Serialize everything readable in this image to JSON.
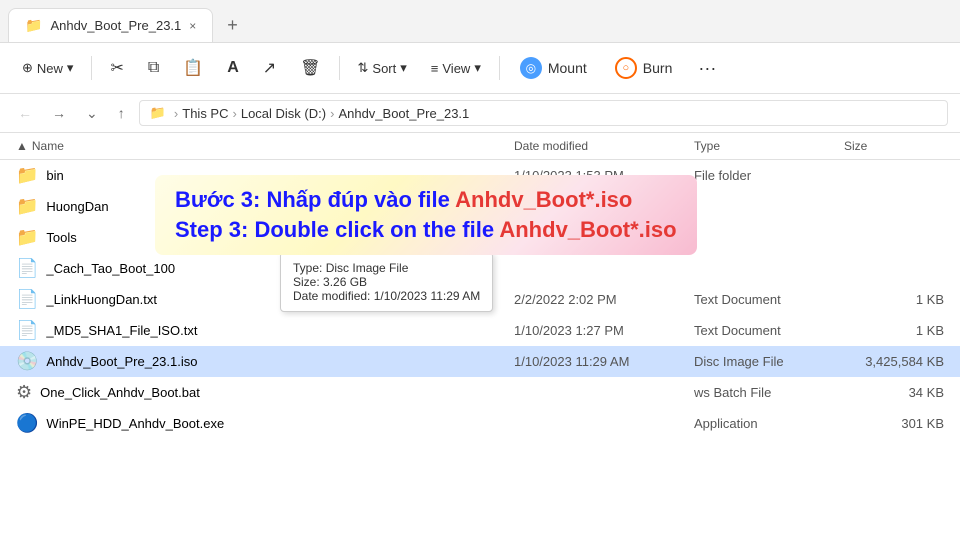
{
  "tab": {
    "title": "Anhdv_Boot_Pre_23.1",
    "close_label": "×"
  },
  "new_tab_label": "+",
  "toolbar": {
    "new_label": "New",
    "cut_label": "✂",
    "copy_label": "⧉",
    "paste_label": "⬜",
    "rename_label": "A",
    "share_label": "↗",
    "delete_label": "🗑",
    "sort_label": "Sort",
    "view_label": "View",
    "mount_label": "Mount",
    "burn_label": "Burn",
    "more_label": "···"
  },
  "breadcrumb": {
    "folder_icon": "📁",
    "items": [
      "This PC",
      "Local Disk (D:)",
      "Anhdv_Boot_Pre_23.1"
    ]
  },
  "file_header": {
    "name": "Name",
    "date_modified": "Date modified",
    "type": "Type",
    "size": "Size"
  },
  "files": [
    {
      "icon": "📁",
      "name": "bin",
      "date": "1/10/2023 1:53 PM",
      "type": "File folder",
      "size": "",
      "is_folder": true
    },
    {
      "icon": "📁",
      "name": "HuongDan",
      "date": "",
      "type": "",
      "size": "",
      "is_folder": true
    },
    {
      "icon": "📁",
      "name": "Tools",
      "date": "",
      "type": "",
      "size": "",
      "is_folder": true
    },
    {
      "icon": "📄",
      "name": "_Cach_Tao_Boot_100",
      "date": "",
      "type": "",
      "size": "",
      "is_folder": false
    },
    {
      "icon": "📄",
      "name": "_LinkHuongDan.txt",
      "date": "2/2/2022 2:02 PM",
      "type": "Text Document",
      "size": "1 KB",
      "is_folder": false
    },
    {
      "icon": "📄",
      "name": "_MD5_SHA1_File_ISO.txt",
      "date": "1/10/2023 1:27 PM",
      "type": "Text Document",
      "size": "1 KB",
      "is_folder": false
    },
    {
      "icon": "💿",
      "name": "Anhdv_Boot_Pre_23.1.iso",
      "date": "1/10/2023 11:29 AM",
      "type": "Disc Image File",
      "size": "3,425,584 KB",
      "is_folder": false,
      "selected": true
    },
    {
      "icon": "⚙",
      "name": "One_Click_Anhdv_Boot.bat",
      "date": "",
      "type": "ws Batch File",
      "size": "34 KB",
      "is_folder": false
    },
    {
      "icon": "🔵",
      "name": "WinPE_HDD_Anhdv_Boot.exe",
      "date": "",
      "type": "Application",
      "size": "301 KB",
      "is_folder": false
    }
  ],
  "tooltip": {
    "type_label": "Type:",
    "type_value": "Disc Image File",
    "size_label": "Size:",
    "size_value": "3.26 GB",
    "date_label": "Date modified:",
    "date_value": "1/10/2023 11:29 AM"
  },
  "instruction": {
    "line1_prefix": "Bước 3: Nhấp đúp vào file ",
    "line1_highlight": "Anhdv_Boot*.iso",
    "line2_prefix": "Step 3: Double click on the file ",
    "line2_highlight": "Anhdv_Boot*.iso"
  }
}
